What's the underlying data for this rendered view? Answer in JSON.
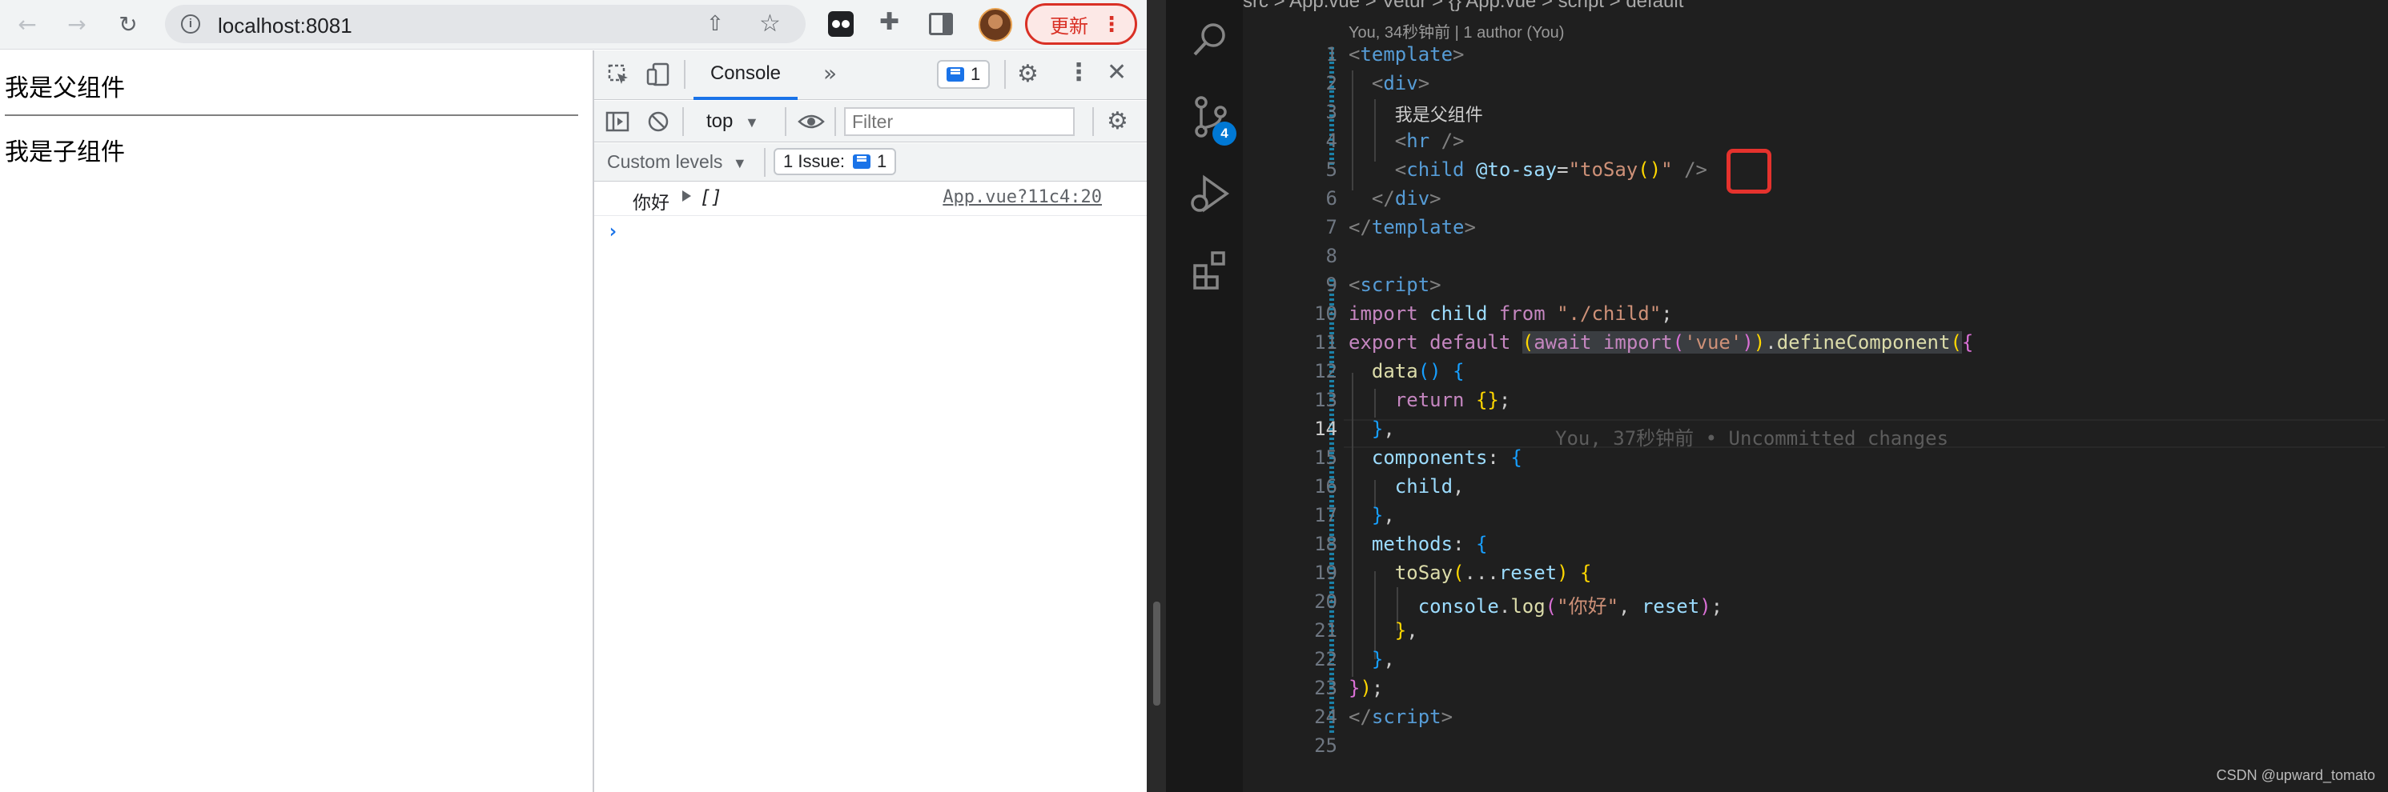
{
  "browser": {
    "address": "localhost:8081",
    "update_label": "更新",
    "icons": {
      "back": "←",
      "forward": "→",
      "reload": "↻",
      "share": "⇧",
      "bookmark": "☆",
      "extensions": "✚",
      "menu": "⋮"
    }
  },
  "page": {
    "parent_text": "我是父组件",
    "child_text": "我是子组件"
  },
  "devtools": {
    "console_tab": "Console",
    "more_tabs": "»",
    "issues_count": "1",
    "context": "top",
    "filter_placeholder": "Filter",
    "levels_label": "Custom levels",
    "issue_label": "1 Issue:",
    "issue_count": "1",
    "log": {
      "message": "你好",
      "value": "[]",
      "source": "App.vue?11c4:20"
    },
    "prompt": "›"
  },
  "vscode": {
    "scm_badge": "4",
    "breadcrumb": "src  >   App.vue  >  Vetur  >  {} App.vue  >  script  >  default",
    "codelens": "You, 34秒钟前 | 1 author (You)",
    "blame": "You, 37秒钟前 • Uncommitted changes",
    "line_numbers": [
      "1",
      "2",
      "3",
      "4",
      "5",
      "6",
      "7",
      "8",
      "9",
      "10",
      "11",
      "12",
      "13",
      "14",
      "15",
      "16",
      "17",
      "18",
      "19",
      "20",
      "21",
      "22",
      "23",
      "24",
      "25"
    ],
    "active_line": "14",
    "code": {
      "l1": "template",
      "l2": "div",
      "l3": "我是父组件",
      "l4": "hr",
      "l5_tag": "child",
      "l5_attr": "@to-say",
      "l5_val": "\"toSay",
      "l5_parens": "()",
      "l6": "div",
      "l7": "template",
      "l9": "script",
      "l10_import": "import",
      "l10_child": "child",
      "l10_from": "from",
      "l10_str": "\"./child\"",
      "l11_export": "export",
      "l11_default": "default",
      "l11_await": "await",
      "l11_import": "import",
      "l11_str": "'vue'",
      "l11_fn": "defineComponent",
      "l12": "data",
      "l13_ret": "return",
      "l15": "components",
      "l16": "child",
      "l18": "methods",
      "l19_fn": "toSay",
      "l19_arg": "reset",
      "l20_obj": "console",
      "l20_fn": "log",
      "l20_str": "\"你好\"",
      "l20_arg": "reset",
      "l24": "script"
    },
    "watermark": "CSDN @upward_tomato"
  }
}
